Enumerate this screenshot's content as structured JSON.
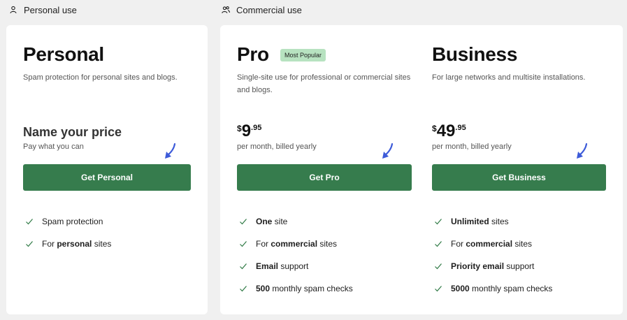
{
  "sections": {
    "personal": {
      "label": "Personal use",
      "icon": "user-icon"
    },
    "commercial": {
      "label": "Commercial use",
      "icon": "users-icon"
    }
  },
  "colors": {
    "accent": "#367c4d",
    "badge": "#b7e2c0",
    "arrow": "#3d5bd9",
    "check": "#2f7a45"
  },
  "plans": [
    {
      "title": "Personal",
      "description": "Spam protection for personal sites and blogs.",
      "price_label": "Name your price",
      "price_sub": "Pay what you can",
      "cta": "Get Personal",
      "features": [
        {
          "pre": "",
          "bold": "",
          "post": "Spam protection"
        },
        {
          "pre": "For ",
          "bold": "personal",
          "post": " sites"
        }
      ]
    },
    {
      "title": "Pro",
      "badge": "Most Popular",
      "description": "Single-site use for professional or commercial sites and blogs.",
      "price_currency": "$",
      "price_whole": "9",
      "price_cents": ".95",
      "price_sub": "per month, billed yearly",
      "cta": "Get Pro",
      "features": [
        {
          "pre": "",
          "bold": "One",
          "post": " site"
        },
        {
          "pre": "For ",
          "bold": "commercial",
          "post": " sites"
        },
        {
          "pre": "",
          "bold": "Email",
          "post": " support"
        },
        {
          "pre": "",
          "bold": "500",
          "post": " monthly spam checks"
        }
      ]
    },
    {
      "title": "Business",
      "description": "For large networks and multisite installations.",
      "price_currency": "$",
      "price_whole": "49",
      "price_cents": ".95",
      "price_sub": "per month, billed yearly",
      "cta": "Get Business",
      "features": [
        {
          "pre": "",
          "bold": "Unlimited",
          "post": " sites"
        },
        {
          "pre": "For ",
          "bold": "commercial",
          "post": " sites"
        },
        {
          "pre": "",
          "bold": "Priority email",
          "post": " support"
        },
        {
          "pre": "",
          "bold": "5000",
          "post": " monthly spam checks"
        }
      ]
    }
  ]
}
